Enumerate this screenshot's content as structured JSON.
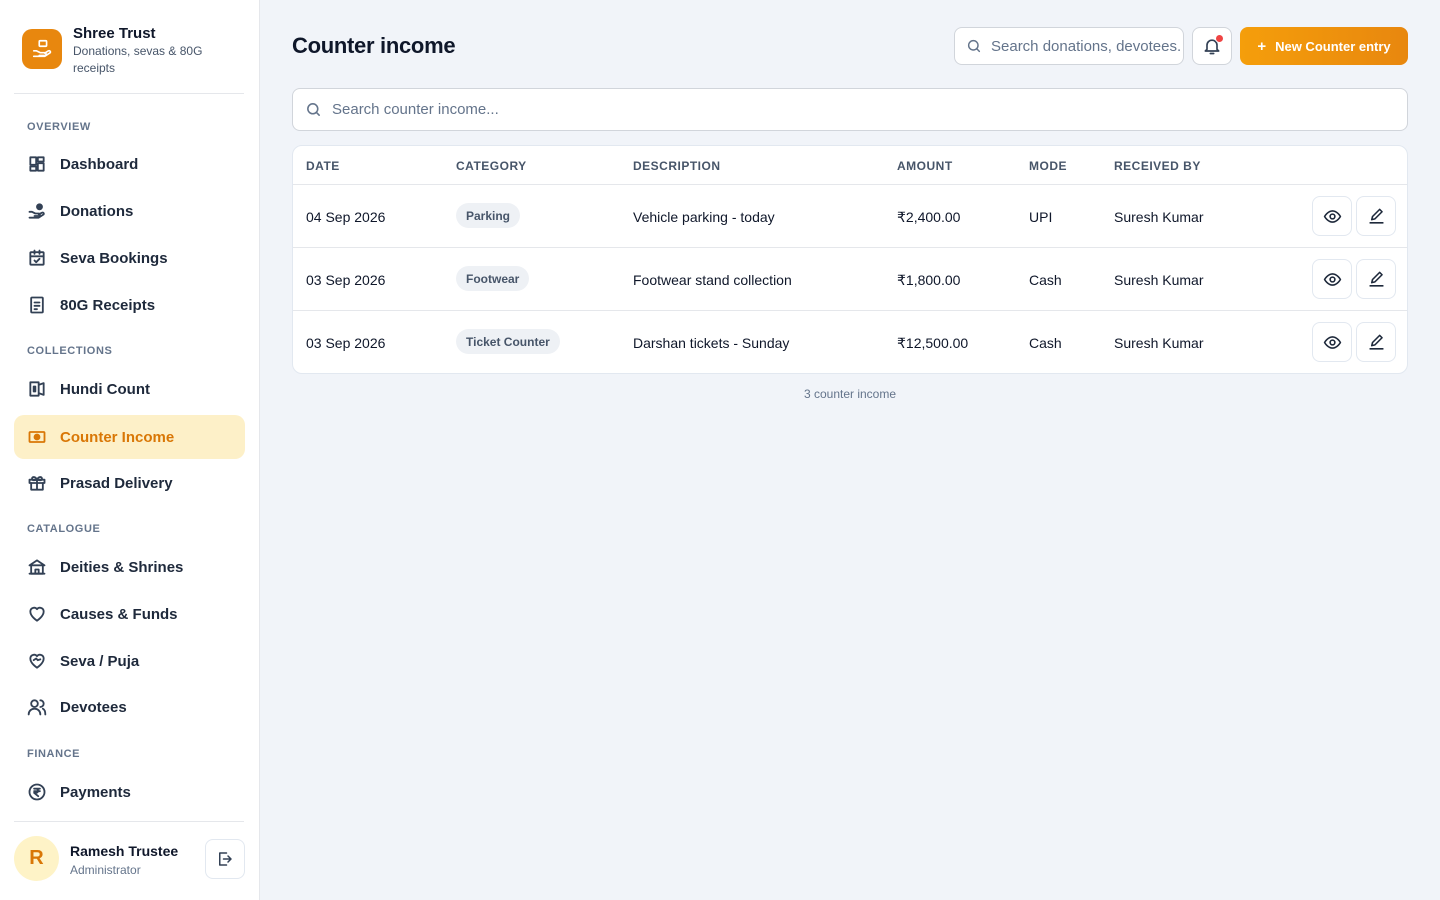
{
  "brand": {
    "name": "Shree Trust",
    "subtitle": "Donations, sevas & 80G receipts"
  },
  "sidebar": {
    "sections": [
      {
        "label": "OVERVIEW"
      },
      {
        "label": "COLLECTIONS"
      },
      {
        "label": "CATALOGUE"
      },
      {
        "label": "FINANCE"
      }
    ],
    "items": [
      {
        "label": "Dashboard",
        "icon": "dashboard-icon"
      },
      {
        "label": "Donations",
        "icon": "hand-coin-icon"
      },
      {
        "label": "Seva Bookings",
        "icon": "calendar-icon"
      },
      {
        "label": "80G Receipts",
        "icon": "receipt-icon"
      },
      {
        "label": "Hundi Count",
        "icon": "hundi-icon"
      },
      {
        "label": "Counter Income",
        "icon": "banknote-icon",
        "active": true
      },
      {
        "label": "Prasad Delivery",
        "icon": "gift-icon"
      },
      {
        "label": "Deities & Shrines",
        "icon": "temple-icon"
      },
      {
        "label": "Causes & Funds",
        "icon": "heart-icon"
      },
      {
        "label": "Seva / Puja",
        "icon": "heart-handshake-icon"
      },
      {
        "label": "Devotees",
        "icon": "users-icon"
      },
      {
        "label": "Payments",
        "icon": "rupee-circle-icon"
      }
    ]
  },
  "user": {
    "initial": "R",
    "name": "Ramesh Trustee",
    "role": "Administrator"
  },
  "header": {
    "title": "Counter income",
    "search_placeholder": "Search donations, devotees...",
    "new_button_label": "New Counter entry"
  },
  "table": {
    "search_placeholder": "Search counter income...",
    "columns": [
      "DATE",
      "CATEGORY",
      "DESCRIPTION",
      "AMOUNT",
      "MODE",
      "RECEIVED BY"
    ],
    "rows": [
      {
        "date": "04 Sep 2026",
        "category": "Parking",
        "description": "Vehicle parking - today",
        "amount": "₹2,400.00",
        "mode": "UPI",
        "received_by": "Suresh Kumar"
      },
      {
        "date": "03 Sep 2026",
        "category": "Footwear",
        "description": "Footwear stand collection",
        "amount": "₹1,800.00",
        "mode": "Cash",
        "received_by": "Suresh Kumar"
      },
      {
        "date": "03 Sep 2026",
        "category": "Ticket Counter",
        "description": "Darshan tickets - Sunday",
        "amount": "₹12,500.00",
        "mode": "Cash",
        "received_by": "Suresh Kumar"
      }
    ],
    "footer": "3 counter income"
  },
  "colors": {
    "accent": "#e8870e",
    "active_bg": "#fdf0c8",
    "active_text": "#d97706",
    "notification_dot": "#ef4444"
  }
}
